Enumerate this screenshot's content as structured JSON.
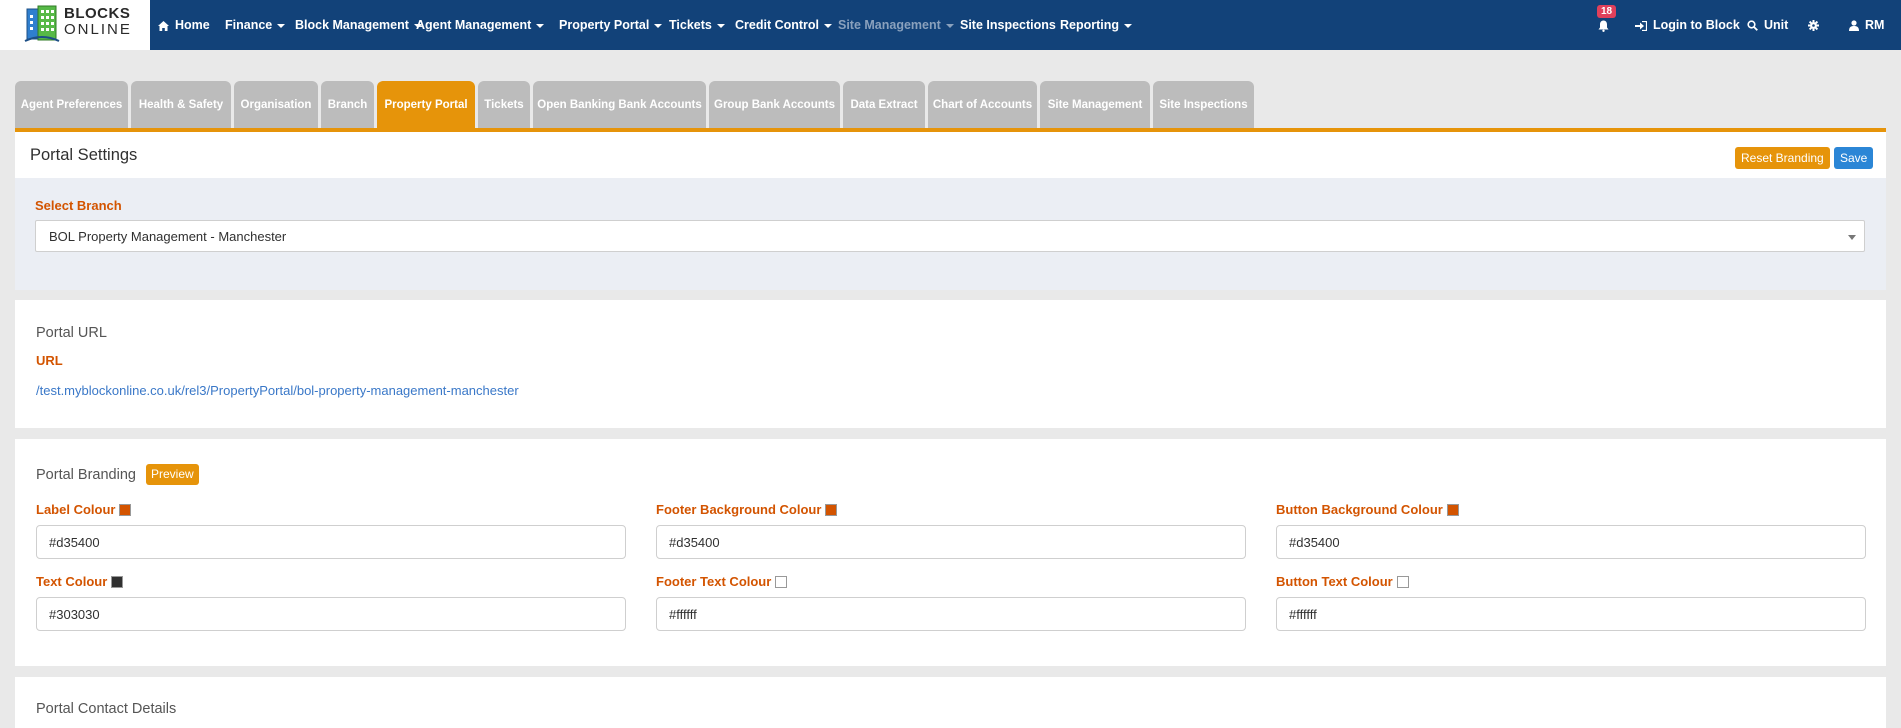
{
  "brand": {
    "line1": "BLOCKS",
    "line2": "ONLINE"
  },
  "nav": {
    "home": "Home",
    "finance": "Finance",
    "block_management": "Block Management",
    "agent_management": "Agent Management",
    "property_portal": "Property Portal",
    "tickets": "Tickets",
    "credit_control": "Credit Control",
    "site_management": "Site Management",
    "site_inspections": "Site Inspections",
    "reporting": "Reporting",
    "notification_count": "18",
    "login_to_block": "Login to Block",
    "unit": "Unit",
    "user": "RM"
  },
  "tabs": [
    "Agent Preferences",
    "Health & Safety",
    "Organisation",
    "Branch",
    "Property Portal",
    "Tickets",
    "Open Banking Bank Accounts",
    "Group Bank Accounts",
    "Data Extract",
    "Chart of Accounts",
    "Site Management",
    "Site Inspections"
  ],
  "active_tab": "Property Portal",
  "header": {
    "title": "Portal Settings",
    "reset_label": "Reset Branding",
    "save_label": "Save"
  },
  "branch": {
    "label": "Select Branch",
    "selected": "BOL Property Management - Manchester"
  },
  "portal_url": {
    "title": "Portal URL",
    "label": "URL",
    "value": "/test.myblockonline.co.uk/rel3/PropertyPortal/bol-property-management-manchester"
  },
  "branding": {
    "title": "Portal Branding",
    "preview_label": "Preview",
    "fields": {
      "label_colour": {
        "label": "Label Colour",
        "value": "#d35400"
      },
      "footer_bg_colour": {
        "label": "Footer Background Colour",
        "value": "#d35400"
      },
      "button_bg_colour": {
        "label": "Button Background Colour",
        "value": "#d35400"
      },
      "text_colour": {
        "label": "Text Colour",
        "value": "#303030"
      },
      "footer_text_colour": {
        "label": "Footer Text Colour",
        "value": "#ffffff"
      },
      "button_text_colour": {
        "label": "Button Text Colour",
        "value": "#ffffff"
      }
    }
  },
  "contact": {
    "title": "Portal Contact Details"
  },
  "colors": {
    "navbar": "#124279",
    "accent_orange": "#e6940a",
    "label_orange": "#d35400",
    "save_blue": "#2b86d6",
    "tab_grey": "#bcbcbc"
  },
  "icons": {
    "home": "home-icon",
    "bell": "bell-icon",
    "login": "sign-in-icon",
    "search": "search-icon",
    "settings": "gear-icon",
    "user": "user-icon"
  }
}
